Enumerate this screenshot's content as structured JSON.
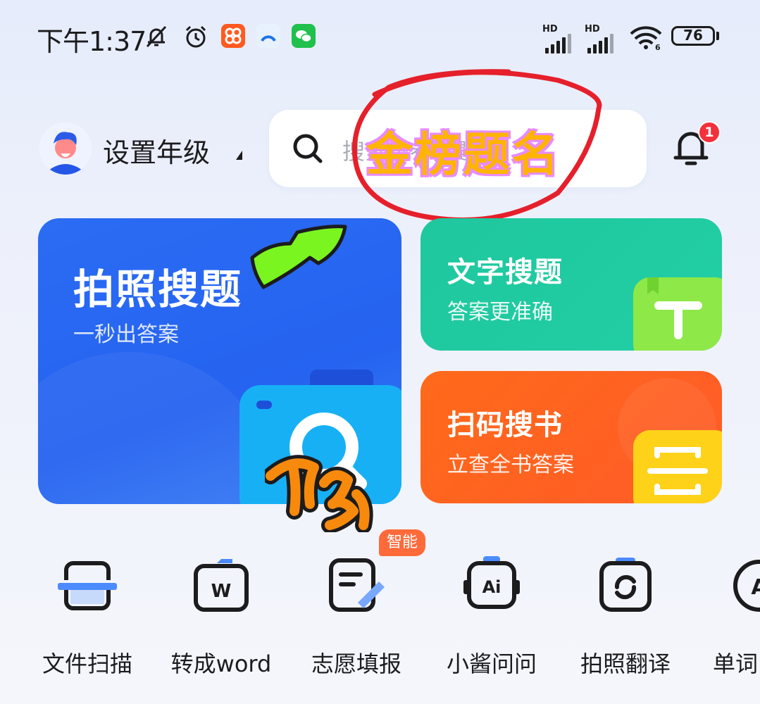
{
  "status_bar": {
    "time": "下午1:37",
    "signal1_hd": "HD",
    "signal2_hd": "HD",
    "battery": "76"
  },
  "header": {
    "grade_label": "设置年级",
    "search_placeholder": "搜索试卷真题",
    "notification_count": "1"
  },
  "overlay": {
    "text": "金榜题名"
  },
  "cards": {
    "photo": {
      "title": "拍照搜题",
      "subtitle": "一秒出答案"
    },
    "text": {
      "title": "文字搜题",
      "subtitle": "答案更准确"
    },
    "scan": {
      "title": "扫码搜书",
      "subtitle": "立查全书答案"
    }
  },
  "tools": {
    "smart_tag": "智能",
    "items": [
      {
        "label": "文件扫描"
      },
      {
        "label": "转成word"
      },
      {
        "label": "志愿填报"
      },
      {
        "label": "小酱问问"
      },
      {
        "label": "拍照翻译"
      },
      {
        "label": "单词"
      }
    ]
  },
  "colors": {
    "primary_blue": "#2563f0",
    "green": "#22cfa5",
    "orange": "#ff5a28",
    "badge_red": "#f2313c"
  }
}
